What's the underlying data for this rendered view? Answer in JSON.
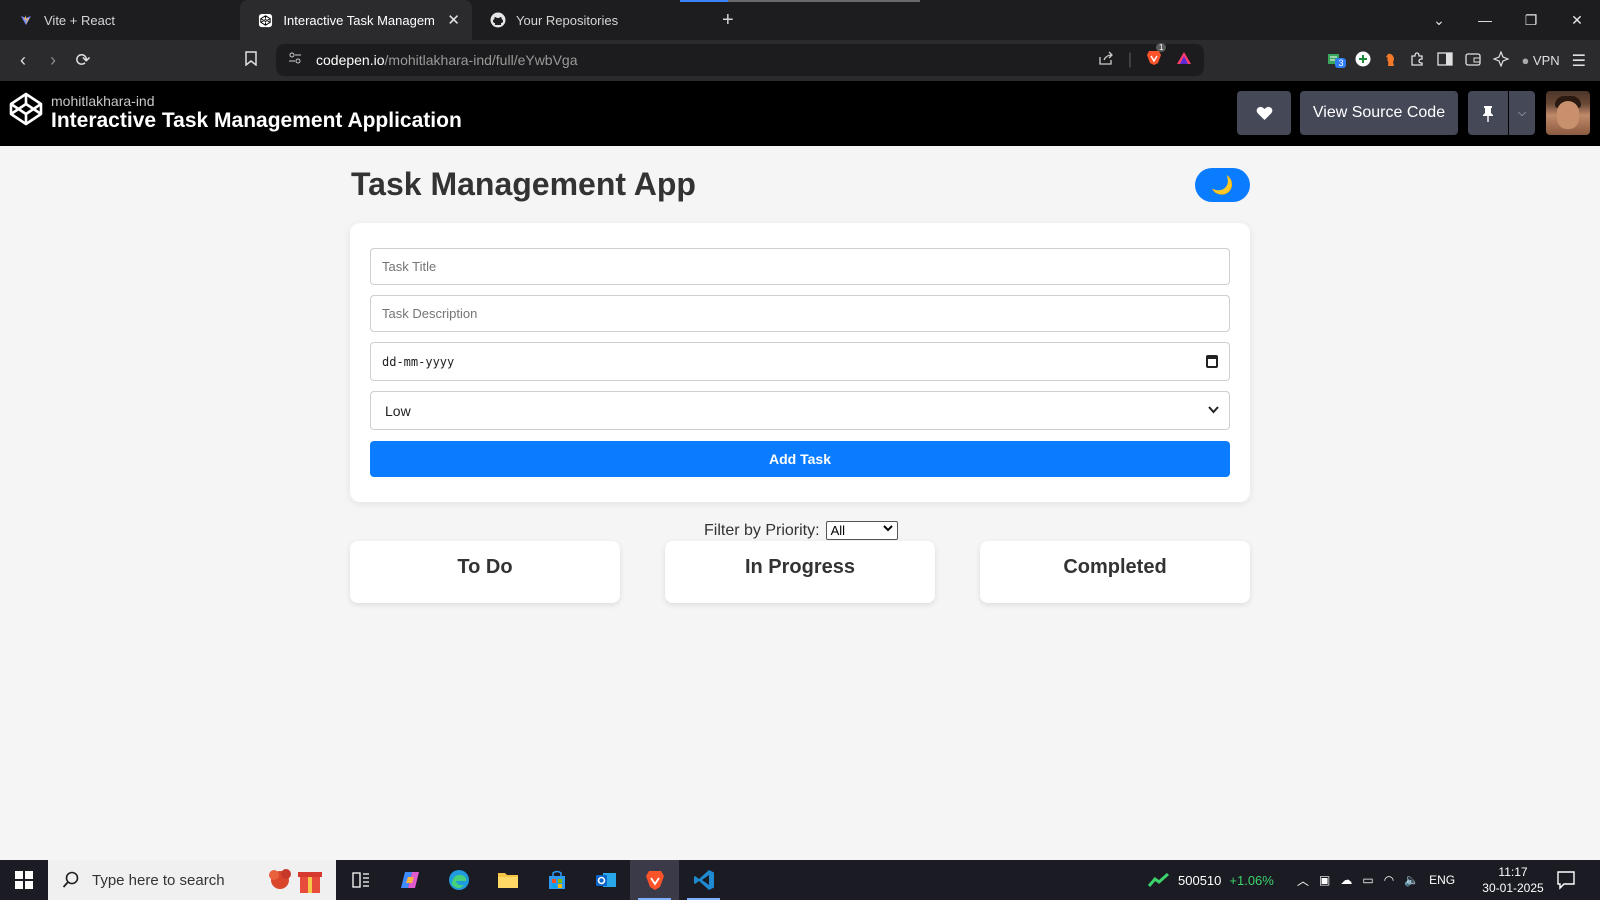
{
  "browser": {
    "tabs": [
      {
        "title": "Vite + React",
        "icon": "vite-icon",
        "active": false
      },
      {
        "title": "Interactive Task Management A",
        "icon": "codepen-icon",
        "active": true
      },
      {
        "title": "Your Repositories",
        "icon": "github-icon",
        "active": false
      }
    ],
    "url_host": "codepen.io",
    "url_path": "/mohitlakhara-ind/full/eYwbVga",
    "shield_badge": "1",
    "ext_badge": "3",
    "vpn_label": "VPN"
  },
  "codepen": {
    "username": "mohitlakhara-ind",
    "pen_title": "Interactive Task Management Application",
    "view_source_label": "View Source Code"
  },
  "app": {
    "title": "Task Management App",
    "theme_toggle_icon": "🌙",
    "form": {
      "title_placeholder": "Task Title",
      "description_placeholder": "Task Description",
      "date_placeholder": "dd-mm-yyyy",
      "priority_value": "Low",
      "add_button_label": "Add Task"
    },
    "filter": {
      "label": "Filter by Priority:",
      "value": "All"
    },
    "columns": [
      "To Do",
      "In Progress",
      "Completed"
    ]
  },
  "taskbar": {
    "search_placeholder": "Type here to search",
    "stock_value": "500510",
    "stock_change": "+1.06%",
    "language": "ENG",
    "time": "11:17",
    "date": "30-01-2025"
  },
  "colors": {
    "accent": "#0a7cff",
    "header_bg": "#000000",
    "codepen_button": "#444857",
    "page_bg": "#f5f5f5"
  }
}
